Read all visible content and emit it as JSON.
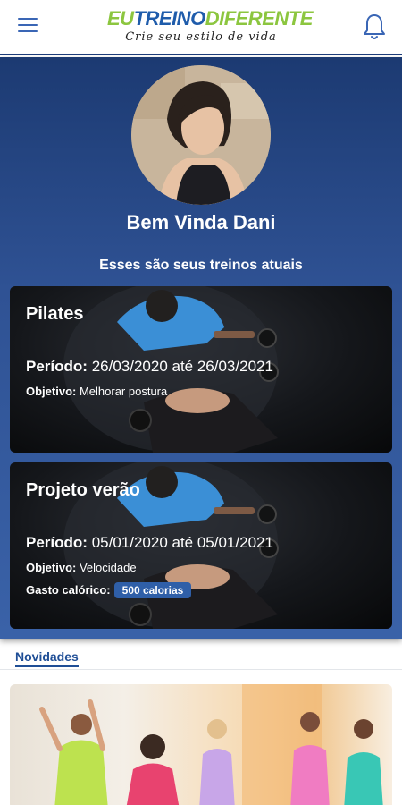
{
  "app": {
    "logo": {
      "part1": "EU",
      "part2": "TREINO",
      "part3": "DIFERENTE",
      "tagline": "Crie seu estilo de vida"
    },
    "icons": {
      "menu": "hamburger-menu-icon",
      "notifications": "bell-icon"
    },
    "colors": {
      "brand_blue": "#1f5cab",
      "brand_green": "#8cc63f",
      "hero_bg": "#2f5294",
      "badge": "#2f5fa8"
    }
  },
  "profile": {
    "welcome": "Bem Vinda Dani",
    "subtitle": "Esses são seus treinos atuais"
  },
  "workouts": [
    {
      "title": "Pilates",
      "period_label": "Período:",
      "period": "26/03/2020 até 26/03/2021",
      "goal_label": "Objetivo:",
      "goal": "Melhorar postura"
    },
    {
      "title": "Projeto verão",
      "period_label": "Período:",
      "period": "05/01/2020 até 05/01/2021",
      "goal_label": "Objetivo:",
      "goal": "Velocidade",
      "calories_label": "Gasto calórico:",
      "calories": "500 calorias"
    }
  ],
  "news": {
    "tab_label": "Novidades"
  }
}
